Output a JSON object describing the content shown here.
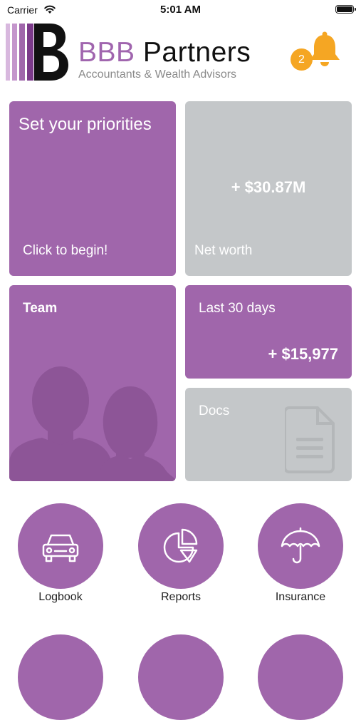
{
  "status_bar": {
    "carrier": "Carrier",
    "time": "5:01 AM"
  },
  "header": {
    "brand_bbb": "BBB",
    "brand_partners": "Partners",
    "tagline": "Accountants & Wealth Advisors",
    "notification_count": "2"
  },
  "tiles": {
    "priorities": {
      "title": "Set your priorities",
      "cta": "Click to begin!"
    },
    "net_worth": {
      "value": "+ $30.87M",
      "label": "Net worth"
    },
    "team": {
      "label": "Team"
    },
    "last_30_days": {
      "label": "Last 30 days",
      "value": "+ $15,977"
    },
    "docs": {
      "label": "Docs"
    }
  },
  "shortcuts": [
    {
      "label": "Logbook",
      "icon": "car-icon"
    },
    {
      "label": "Reports",
      "icon": "pie-chart-icon"
    },
    {
      "label": "Insurance",
      "icon": "umbrella-icon"
    }
  ],
  "colors": {
    "purple": "#a066ab",
    "grey": "#c4c7c9",
    "badge": "#f5a623"
  }
}
